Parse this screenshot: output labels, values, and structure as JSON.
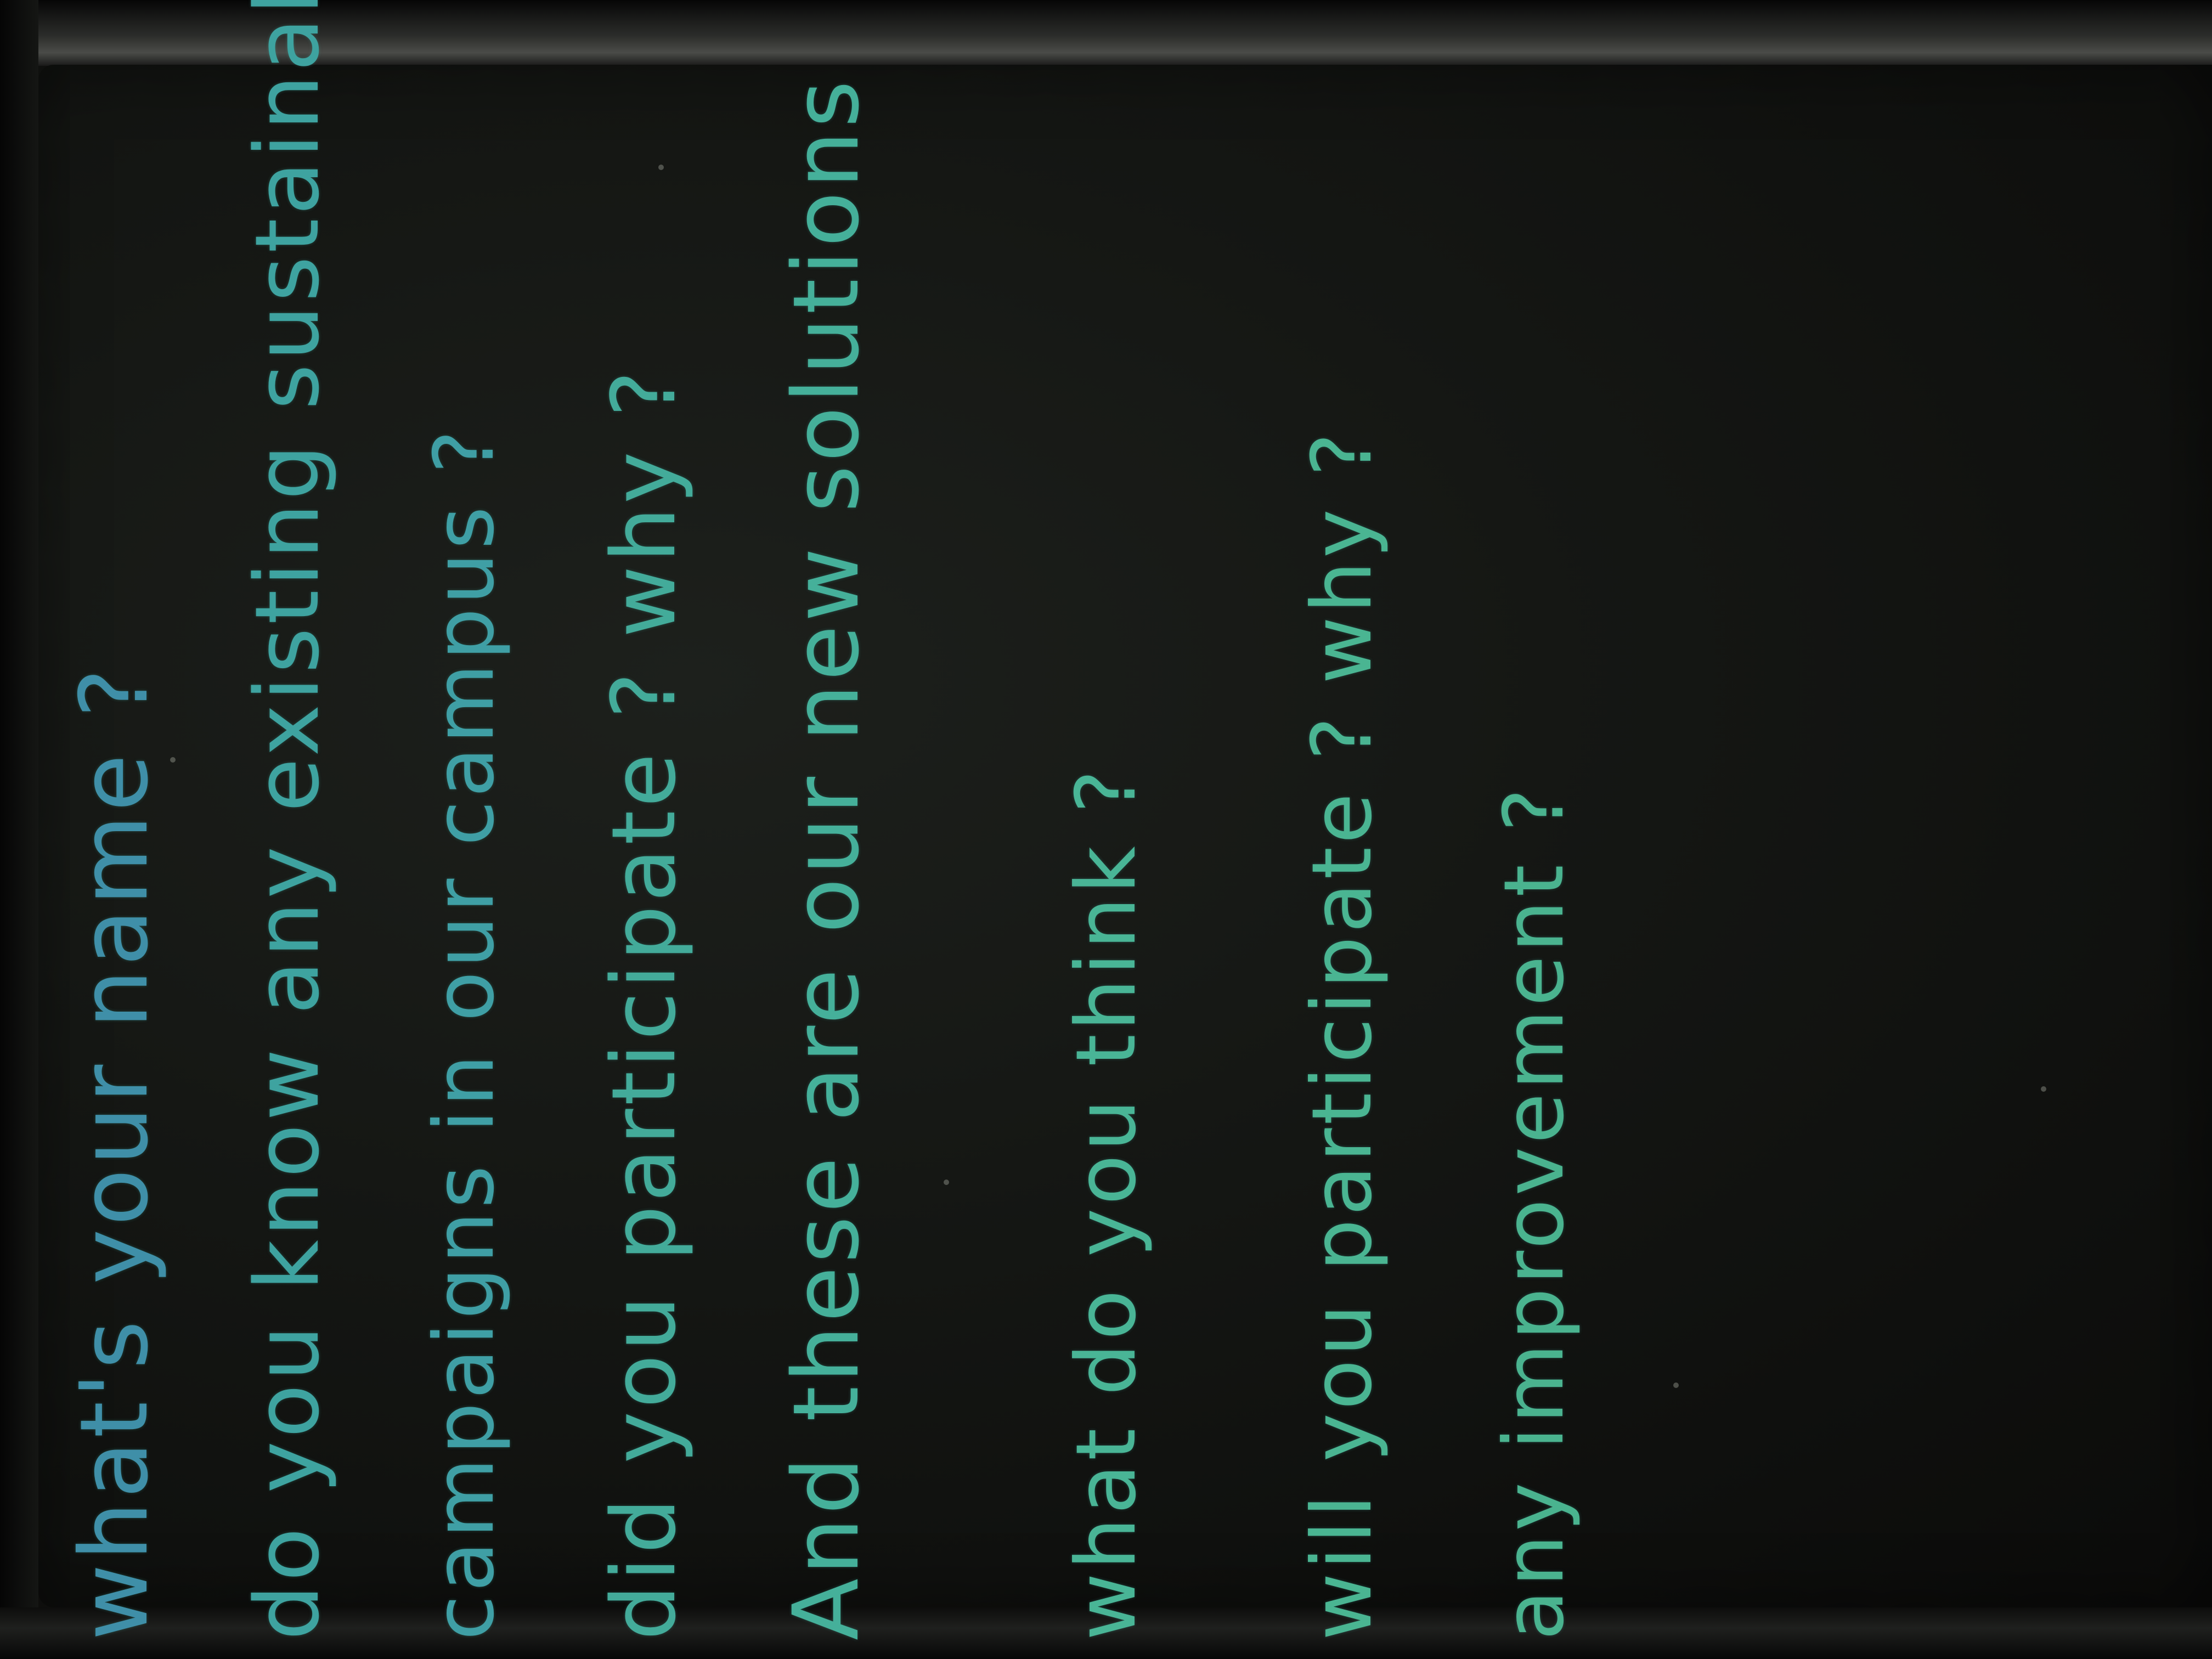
{
  "board": {
    "ink_color": "#3fa99a",
    "background_color": "#141613",
    "lines": [
      "what's your name ?",
      "do you know any existing sustainable",
      "campaigns in our campus ?",
      "did you participate ? why ?",
      "And these are our new solutions",
      "what do you think ?",
      "will you participate ? why ?",
      "any improvement ?"
    ]
  }
}
